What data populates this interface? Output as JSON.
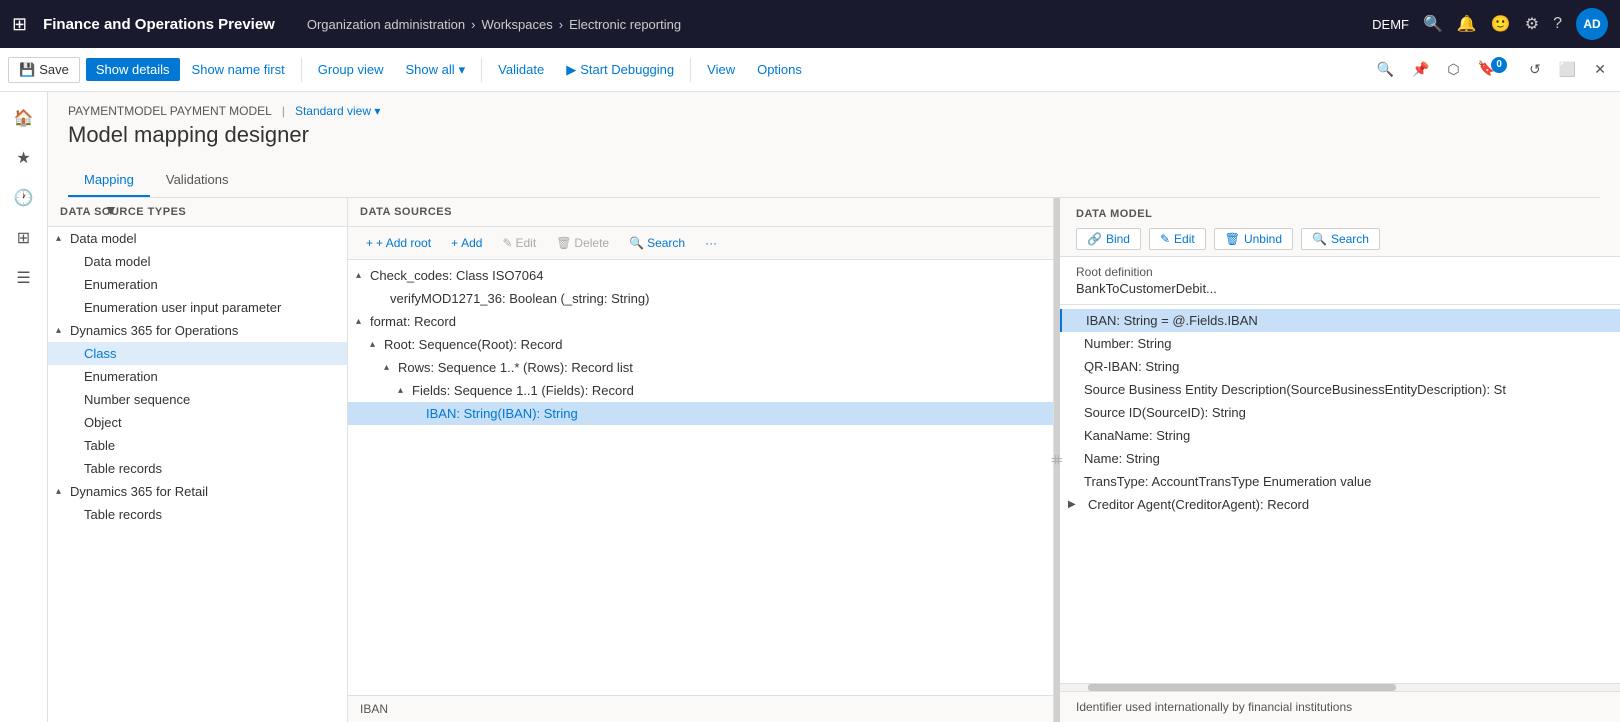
{
  "app": {
    "title": "Finance and Operations Preview",
    "grid_icon": "⊞"
  },
  "breadcrumb": {
    "items": [
      "Organization administration",
      "Workspaces",
      "Electronic reporting"
    ],
    "separator": "›"
  },
  "top_right": {
    "env": "DEMF",
    "avatar": "AD"
  },
  "toolbar": {
    "save": "Save",
    "show_details": "Show details",
    "show_name_first": "Show name first",
    "group_view": "Group view",
    "show_all": "Show all",
    "validate": "Validate",
    "start_debugging": "Start Debugging",
    "view": "View",
    "options": "Options"
  },
  "page": {
    "breadcrumb_left": "PAYMENTMODEL PAYMENT MODEL",
    "breadcrumb_sep": "|",
    "breadcrumb_view": "Standard view ▾",
    "title": "Model mapping designer"
  },
  "tabs": {
    "items": [
      {
        "label": "Mapping",
        "active": true
      },
      {
        "label": "Validations",
        "active": false
      }
    ]
  },
  "left_panel": {
    "header": "DATA SOURCE TYPES",
    "tree": [
      {
        "label": "Data model",
        "indent": 0,
        "arrow": "▴",
        "expanded": true
      },
      {
        "label": "Data model",
        "indent": 1,
        "arrow": "",
        "expanded": false
      },
      {
        "label": "Enumeration",
        "indent": 1,
        "arrow": "",
        "expanded": false
      },
      {
        "label": "Enumeration user input parameter",
        "indent": 1,
        "arrow": "",
        "expanded": false
      },
      {
        "label": "Dynamics 365 for Operations",
        "indent": 0,
        "arrow": "▴",
        "expanded": true
      },
      {
        "label": "Class",
        "indent": 1,
        "arrow": "",
        "expanded": false,
        "selected": true
      },
      {
        "label": "Enumeration",
        "indent": 1,
        "arrow": "",
        "expanded": false
      },
      {
        "label": "Number sequence",
        "indent": 1,
        "arrow": "",
        "expanded": false
      },
      {
        "label": "Object",
        "indent": 1,
        "arrow": "",
        "expanded": false
      },
      {
        "label": "Table",
        "indent": 1,
        "arrow": "",
        "expanded": false
      },
      {
        "label": "Table records",
        "indent": 1,
        "arrow": "",
        "expanded": false
      },
      {
        "label": "Dynamics 365 for Retail",
        "indent": 0,
        "arrow": "▴",
        "expanded": true
      },
      {
        "label": "Table records",
        "indent": 1,
        "arrow": "",
        "expanded": false
      }
    ]
  },
  "middle_panel": {
    "header": "DATA SOURCES",
    "toolbar": {
      "add_root": "+ Add root",
      "add": "+ Add",
      "edit": "✎ Edit",
      "delete": "🗑 Delete",
      "search": "🔍 Search",
      "more": "···"
    },
    "tree": [
      {
        "label": "Check_codes: Class ISO7064",
        "indent": 0,
        "arrow": "▴",
        "expanded": true
      },
      {
        "label": "verifyMOD1271_36: Boolean (_string: String)",
        "indent": 1,
        "arrow": ""
      },
      {
        "label": "format: Record",
        "indent": 0,
        "arrow": "▴",
        "expanded": true
      },
      {
        "label": "Root: Sequence(Root): Record",
        "indent": 1,
        "arrow": "▴",
        "expanded": true
      },
      {
        "label": "Rows: Sequence 1..* (Rows): Record list",
        "indent": 2,
        "arrow": "▴",
        "expanded": true
      },
      {
        "label": "Fields: Sequence 1..1 (Fields): Record",
        "indent": 3,
        "arrow": "▴",
        "expanded": true
      },
      {
        "label": "IBAN: String(IBAN): String",
        "indent": 4,
        "arrow": "",
        "selected": true
      }
    ],
    "footer": "IBAN"
  },
  "right_panel": {
    "header": "DATA MODEL",
    "toolbar": {
      "bind": "Bind",
      "edit": "Edit",
      "unbind": "Unbind",
      "search": "Search"
    },
    "root_def_label": "Root definition",
    "root_def_value": "BankToCustomerDebit...",
    "tree": [
      {
        "label": "IBAN: String = @.Fields.IBAN",
        "indent": 0,
        "arrow": "",
        "selected": true
      },
      {
        "label": "Number: String",
        "indent": 0,
        "arrow": ""
      },
      {
        "label": "QR-IBAN: String",
        "indent": 0,
        "arrow": ""
      },
      {
        "label": "Source Business Entity Description(SourceBusinessEntityDescription): St",
        "indent": 0,
        "arrow": ""
      },
      {
        "label": "Source ID(SourceID): String",
        "indent": 0,
        "arrow": ""
      },
      {
        "label": "KanaName: String",
        "indent": 0,
        "arrow": ""
      },
      {
        "label": "Name: String",
        "indent": 0,
        "arrow": ""
      },
      {
        "label": "TransType: AccountTransType Enumeration value",
        "indent": 0,
        "arrow": ""
      },
      {
        "label": "Creditor Agent(CreditorAgent): Record",
        "indent": 0,
        "arrow": "▶"
      }
    ],
    "footer": "Identifier used internationally by financial institutions"
  }
}
